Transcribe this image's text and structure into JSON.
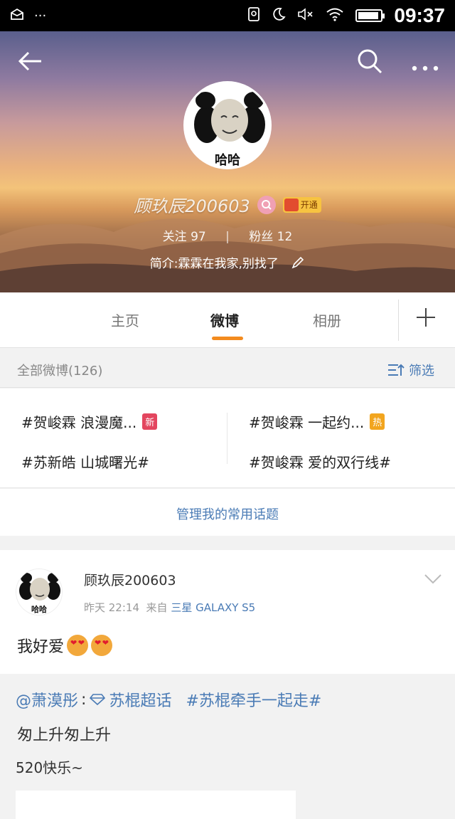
{
  "status_bar": {
    "time": "09:37"
  },
  "profile": {
    "avatar_caption": "哈哈",
    "username": "顾玖辰200603",
    "vip_label": "开通",
    "following_label": "关注",
    "following_count": "97",
    "followers_label": "粉丝",
    "followers_count": "12",
    "bio": "简介:霖霖在我家,别找了"
  },
  "tabs": [
    {
      "label": "主页"
    },
    {
      "label": "微博"
    },
    {
      "label": "相册"
    }
  ],
  "filter": {
    "count_label": "全部微博(126)",
    "filter_label": "筛选"
  },
  "topics": [
    {
      "text": "#贺峻霖 浪漫魔...",
      "tag": "新"
    },
    {
      "text": "#贺峻霖 一起约...",
      "tag": "热"
    },
    {
      "text": "#苏新皓 山城曙光#"
    },
    {
      "text": "#贺峻霖 爱的双行线#"
    }
  ],
  "manage_label": "管理我的常用话题",
  "post": {
    "author": "顾玖辰200603",
    "avatar_caption": "哈哈",
    "time": "昨天 22:14",
    "source_prefix": "来自",
    "source": "三星 GALAXY S5",
    "text": "我好爱",
    "repost": {
      "mention": "@萧漠彤",
      "colon": ":",
      "super_topic": "苏棍超话",
      "hashtag": "#苏棍牵手一起走#",
      "line2": "匆上升匆上升",
      "line3": "520快乐~"
    }
  }
}
